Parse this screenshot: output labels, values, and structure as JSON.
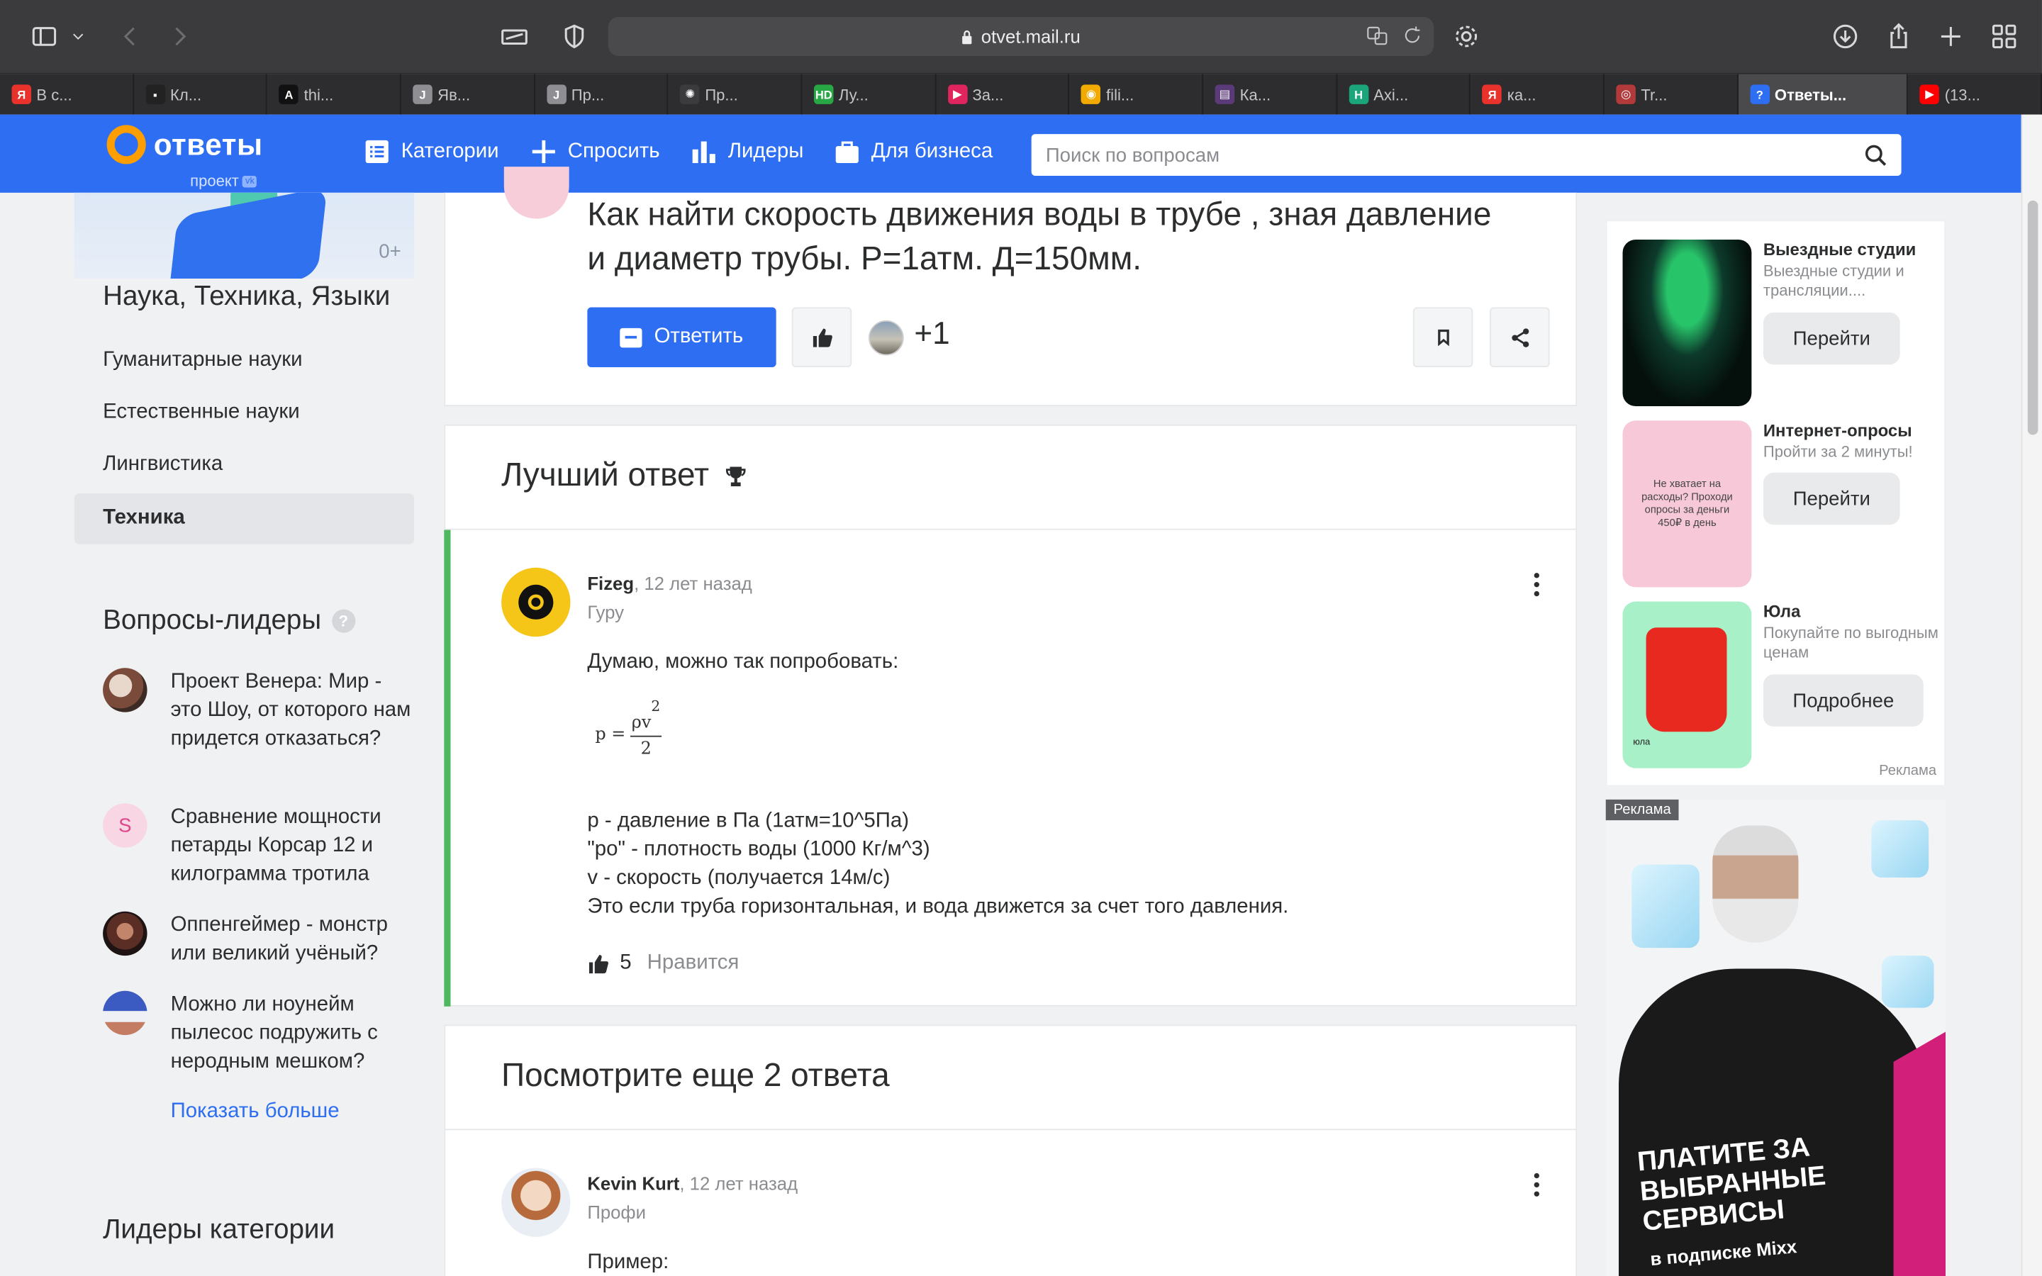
{
  "browser": {
    "url": "otvet.mail.ru",
    "tabs": [
      {
        "label": "В с...",
        "fav": "Я",
        "color": "#e8322b"
      },
      {
        "label": "Кл...",
        "fav": "▪",
        "color": "#222222"
      },
      {
        "label": "thi...",
        "fav": "A",
        "color": "#111111"
      },
      {
        "label": "Яв...",
        "fav": "J",
        "color": "#8e8e93"
      },
      {
        "label": "Пр...",
        "fav": "J",
        "color": "#8e8e93"
      },
      {
        "label": "Пр...",
        "fav": "✺",
        "color": "#3b3b3d"
      },
      {
        "label": "Лу...",
        "fav": "HD",
        "color": "#28a745"
      },
      {
        "label": "За...",
        "fav": "▶",
        "color": "#e0245e"
      },
      {
        "label": "fili...",
        "fav": "◉",
        "color": "#f2a900"
      },
      {
        "label": "Ка...",
        "fav": "▤",
        "color": "#5b3a7a"
      },
      {
        "label": "Axi...",
        "fav": "H",
        "color": "#1aa67a"
      },
      {
        "label": "ка...",
        "fav": "Я",
        "color": "#e8322b"
      },
      {
        "label": "Tr...",
        "fav": "◎",
        "color": "#b23a3a"
      },
      {
        "label": "Ответы...",
        "fav": "?",
        "color": "#2d6ef2",
        "active": true
      },
      {
        "label": "(13...",
        "fav": "▶",
        "color": "#ff0000"
      }
    ]
  },
  "header": {
    "logo_word": "ответы",
    "logo_sub": "проект",
    "logo_badge": "vk",
    "nav": {
      "categories": "Категории",
      "ask": "Спросить",
      "leaders": "Лидеры",
      "business": "Для бизнеса"
    },
    "search_placeholder": "Поиск по вопросам"
  },
  "sidebar": {
    "age": "0+",
    "category_title": "Наука, Техника, Языки",
    "links": [
      "Гуманитарные науки",
      "Естественные науки",
      "Лингвистика"
    ],
    "active_link": "Техника",
    "leaders_title": "Вопросы-лидеры",
    "leaders_help": "?",
    "leader_questions": [
      {
        "text": "Проект Венера: Мир - это Шоу, от которого нам придется отказаться?"
      },
      {
        "text": "Сравнение мощности петарды Корсар 12 и килограмма тротила",
        "initial": "S"
      },
      {
        "text": "Оппенгеймер - монстр или великий учёный?"
      },
      {
        "text": "Можно ли ноунейм пылесос подружить с неродным мешком?"
      }
    ],
    "show_more": "Показать больше",
    "category_leaders": "Лидеры категории"
  },
  "question": {
    "title": "Как найти скорость движения воды в трубе , зная давление и диаметр трубы. Р=1атм. Д=150мм.",
    "answer_button": "Ответить",
    "plus_count": "+1"
  },
  "best_answer": {
    "heading": "Лучший ответ",
    "author": "Fizeg",
    "time": ", 12 лет назад",
    "rank": "Гуру",
    "intro": "Думаю, можно так попробовать:",
    "formula": {
      "lhs": "p =",
      "num": "ρv",
      "exp": "2",
      "den": "2"
    },
    "lines": [
      "p - давление в Па (1атм=10^5Па)",
      "\"ро\" - плотность воды (1000 Кг/м^3)",
      "v - скорость (получается 14м/с)",
      "Это если труба горизонтальная, и вода движется за счет того давления."
    ],
    "likes": "5",
    "like_label": "Нравится"
  },
  "more_answers": {
    "heading": "Посмотрите еще 2 ответа",
    "author": "Kevin Kurt",
    "time": ", 12 лет назад",
    "rank": "Профи",
    "intro": "Пример:"
  },
  "ads": {
    "items": [
      {
        "title": "Выездные студии",
        "desc": "Выездные студии и трансляции....",
        "button": "Перейти"
      },
      {
        "title": "Интернет-опросы",
        "desc": "Пройти за 2 минуты!",
        "button": "Перейти",
        "img_text": "Не хватает на расходы? Проходи опросы за деньги 450₽ в день"
      },
      {
        "title": "Юла",
        "desc": "Покупайте по выгодным ценам",
        "button": "Подробнее",
        "img_text": "юла"
      }
    ],
    "mark": "Реклама",
    "banner_tag": "Реклама",
    "banner_slogan": "Платите за выбранные сервисы",
    "banner_sub": "в подписке Mixx"
  }
}
